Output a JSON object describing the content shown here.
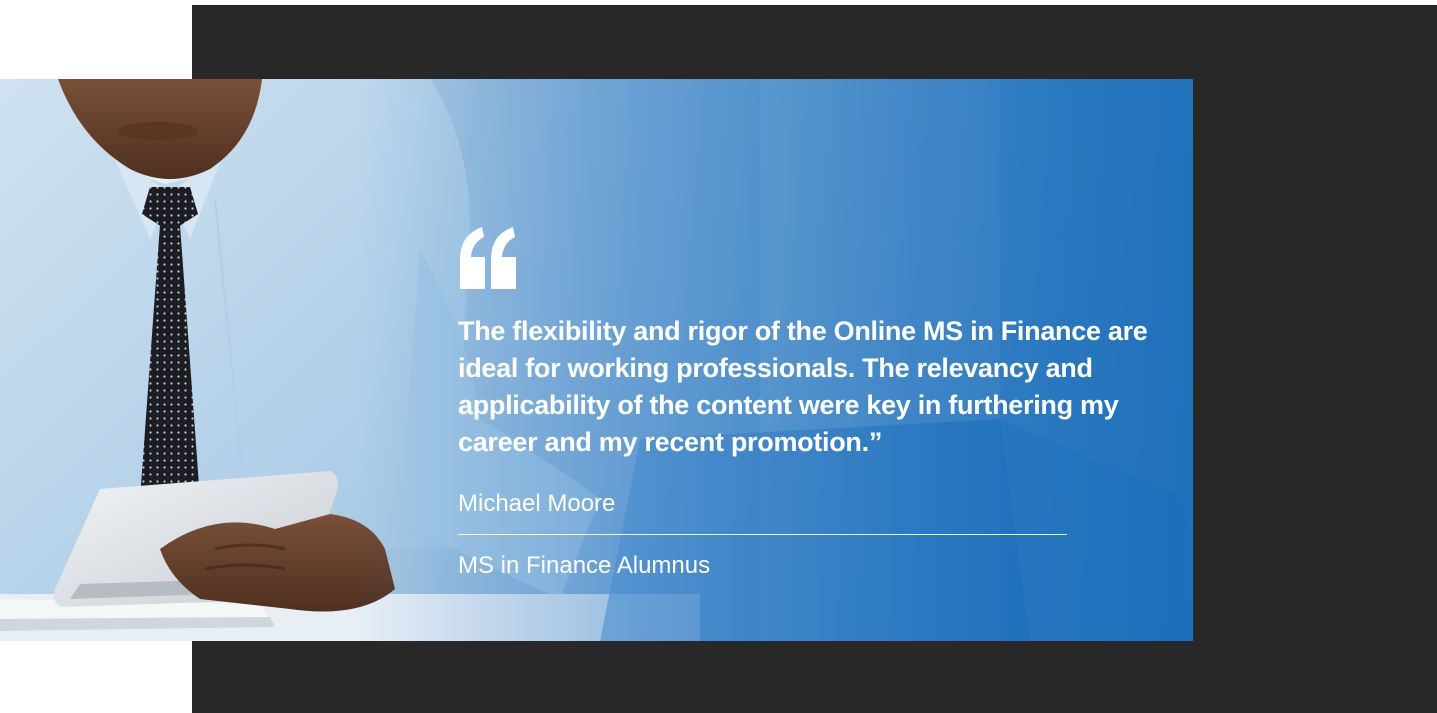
{
  "testimonial": {
    "quote": "The flexibility and rigor of the Online MS in Finance are ideal for working professionals. The relevancy and applicability of the content were key in furthering my career and my recent promotion.”",
    "author": "Michael Moore",
    "role": "MS in Finance Alumnus"
  },
  "icons": {
    "quote_mark": "quote-open-icon"
  },
  "colors": {
    "dark_panel": "#282828",
    "accent_blue": "#0f67b7",
    "text": "#ffffff"
  }
}
